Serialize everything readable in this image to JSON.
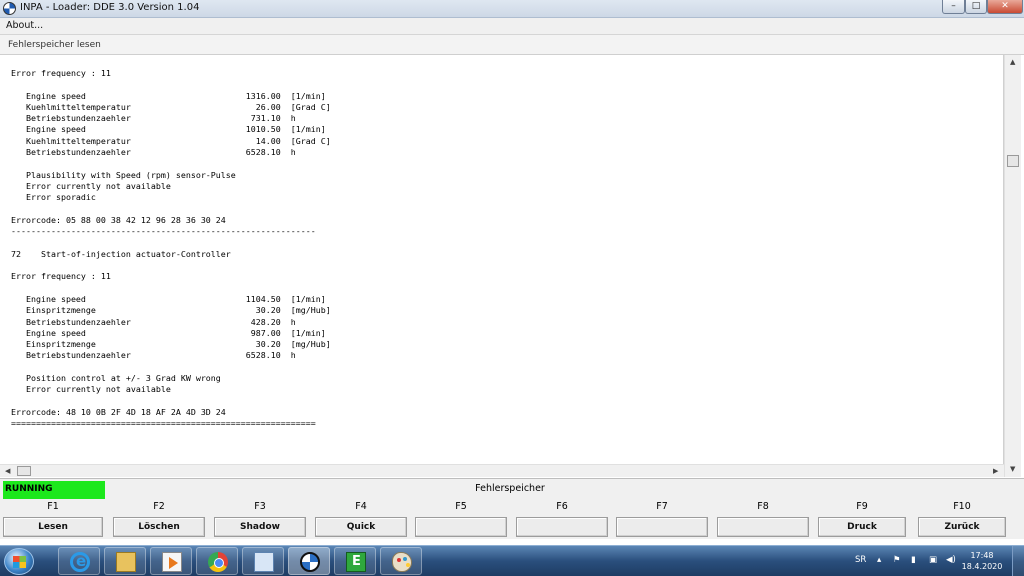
{
  "window": {
    "title": "INPA - Loader:  DDE 3.0 Version 1.04",
    "controls": {
      "minimize": "–",
      "maximize": "□",
      "close": "✕"
    }
  },
  "menu": {
    "about": "About..."
  },
  "content": {
    "header": "Fehlerspeicher lesen",
    "lines": [
      "Error frequency : 11",
      "",
      "   Engine speed                                1316.00  [1/min]",
      "   Kuehlmitteltemperatur                         26.00  [Grad C]",
      "   Betriebstundenzaehler                        731.10  h",
      "   Engine speed                                1010.50  [1/min]",
      "   Kuehlmitteltemperatur                         14.00  [Grad C]",
      "   Betriebstundenzaehler                       6528.10  h",
      "",
      "   Plausibility with Speed (rpm) sensor-Pulse",
      "   Error currently not available",
      "   Error sporadic",
      "",
      "Errorcode: 05 88 00 38 42 12 96 28 36 30 24",
      "-------------------------------------------------------------",
      "",
      "72    Start-of-injection actuator-Controller",
      "",
      "Error frequency : 11",
      "",
      "   Engine speed                                1104.50  [1/min]",
      "   Einspritzmenge                                30.20  [mg/Hub]",
      "   Betriebstundenzaehler                        428.20  h",
      "   Engine speed                                 987.00  [1/min]",
      "   Einspritzmenge                                30.20  [mg/Hub]",
      "   Betriebstundenzaehler                       6528.10  h",
      "",
      "   Position control at +/- 3 Grad KW wrong",
      "   Error currently not available",
      "",
      "Errorcode: 48 10 0B 2F 4D 18 AF 2A 4D 3D 24",
      "============================================================="
    ]
  },
  "status": {
    "state": "RUNNING",
    "state_color": "#1ce81c",
    "title": "Fehlerspeicher"
  },
  "function_keys": [
    {
      "key": "F1",
      "label": "Lesen"
    },
    {
      "key": "F2",
      "label": "Löschen"
    },
    {
      "key": "F3",
      "label": "Shadow"
    },
    {
      "key": "F4",
      "label": "Quick"
    },
    {
      "key": "F5",
      "label": ""
    },
    {
      "key": "F6",
      "label": ""
    },
    {
      "key": "F7",
      "label": ""
    },
    {
      "key": "F8",
      "label": ""
    },
    {
      "key": "F9",
      "label": "Druck"
    },
    {
      "key": "F10",
      "label": "Zurück"
    }
  ],
  "taskbar": {
    "apps": [
      "internet-explorer-icon",
      "file-explorer-icon",
      "media-player-icon",
      "chrome-icon",
      "remote-desktop-icon",
      "bmw-inpa-icon",
      "ediabas-icon",
      "paint-icon"
    ],
    "language": "SR",
    "clock_time": "17:48",
    "clock_date": "18.4.2020"
  }
}
